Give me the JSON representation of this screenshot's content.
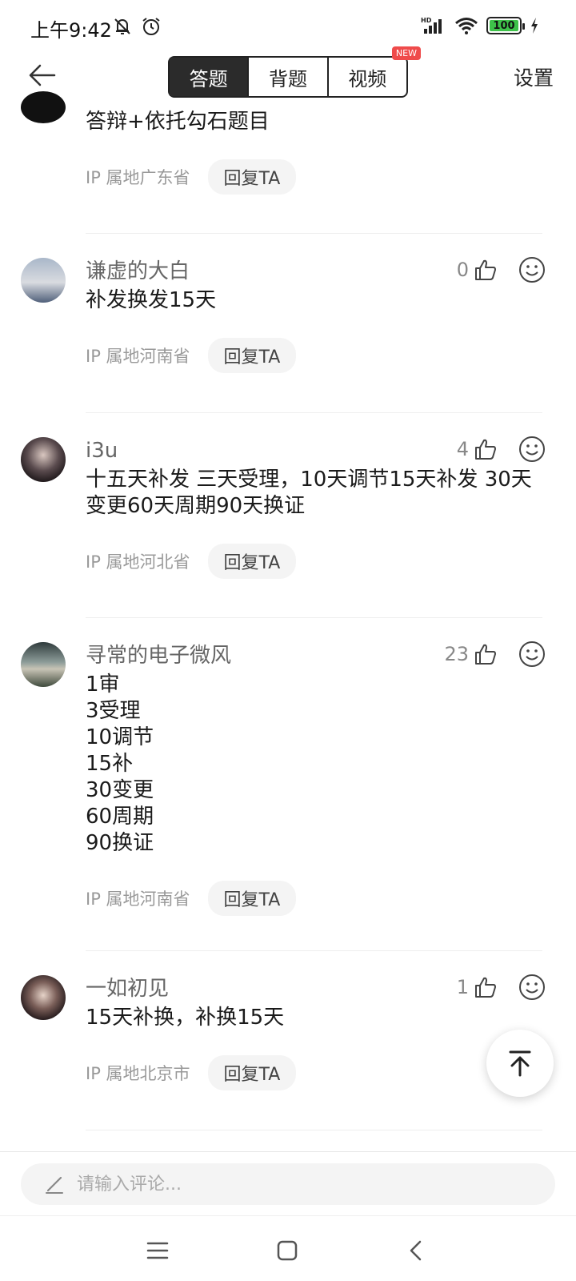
{
  "status": {
    "time": "上午9:42",
    "battery": "100",
    "network": "HD"
  },
  "nav": {
    "tabs": [
      "答题",
      "背题",
      "视频"
    ],
    "active_tab": "答题",
    "new_badge": "NEW",
    "settings_label": "设置"
  },
  "comments": [
    {
      "username": "",
      "content": "答辩+依托勾石题目",
      "ip": "IP 属地广东省",
      "reply": "回复TA",
      "likes": "",
      "avatar": "avatar-partial"
    },
    {
      "username": "谦虚的大白",
      "content": "补发换发15天",
      "ip": "IP 属地河南省",
      "reply": "回复TA",
      "likes": "0",
      "avatar": "avatar-landscape"
    },
    {
      "username": "i3u",
      "content": "十五天补发 三天受理，10天调节15天补发 30天变更60天周期90天换证",
      "ip": "IP 属地河北省",
      "reply": "回复TA",
      "likes": "4",
      "avatar": "avatar-person-dark"
    },
    {
      "username": "寻常的电子微风",
      "content": "1审\n3受理\n10调节\n15补\n30变更\n60周期\n90换证",
      "ip": "IP 属地河南省",
      "reply": "回复TA",
      "likes": "23",
      "avatar": "avatar-beach"
    },
    {
      "username": "一如初见",
      "content": "15天补换，补换15天",
      "ip": "IP 属地北京市",
      "reply": "回复TA",
      "likes": "1",
      "avatar": "avatar-portrait"
    }
  ],
  "input": {
    "placeholder": "请输入评论..."
  },
  "colors": {
    "active_tab_bg": "#2b2b2b",
    "badge": "#ef4b4b",
    "battery": "#3ec24a"
  }
}
